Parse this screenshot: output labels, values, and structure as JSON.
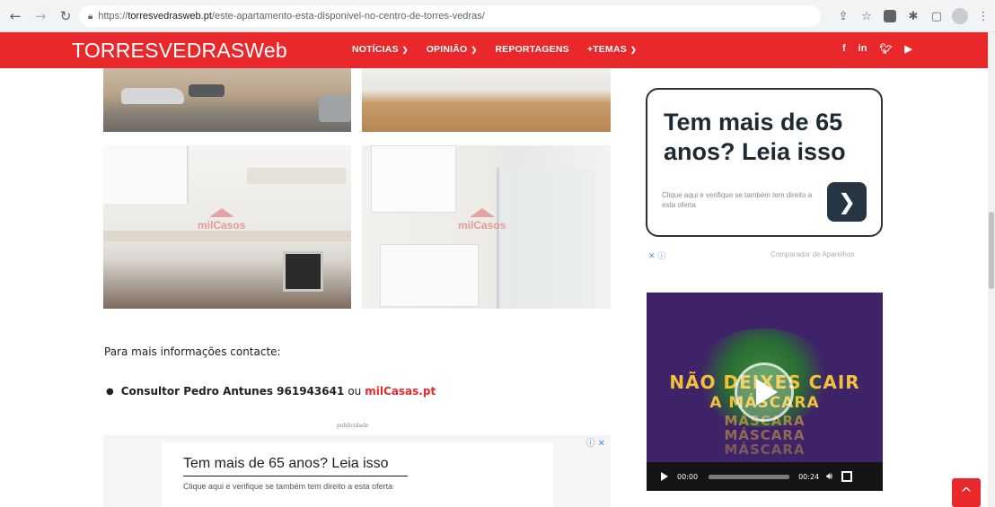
{
  "browser": {
    "url_prefix": "https://",
    "url_domain": "torresvedrasweb.pt",
    "url_path": "/este-apartamento-esta-disponivel-no-centro-de-torres-vedras/",
    "back_icon": "arrow-left-icon",
    "forward_icon": "arrow-right-icon",
    "reload_icon": "reload-icon",
    "lock_icon": "lock-icon"
  },
  "site": {
    "logo_bold": "TORRESVEDRAS",
    "logo_light": "Web",
    "brand_color": "#e8282b",
    "nav": [
      {
        "label": "NOTÍCIAS",
        "has_caret": true
      },
      {
        "label": "OPINIÃO",
        "has_caret": true
      },
      {
        "label": "REPORTAGENS",
        "has_caret": false
      },
      {
        "label": "+TEMAS",
        "has_caret": true
      }
    ],
    "social": [
      "f",
      "in",
      "twitter-icon",
      "youtube-icon"
    ]
  },
  "photos": {
    "watermark": "milCasos"
  },
  "content": {
    "info_text": "Para mais informações contacte:",
    "contact_name": "Consultor Pedro Antunes 961943641",
    "contact_or": "ou",
    "contact_link": "milCasas.pt",
    "pub_label": "publicidade"
  },
  "bottom_ad": {
    "title": "Tem mais de 65 anos? Leia isso",
    "subtitle": "Clique aqui e verifique se também tem direito a esta oferta",
    "choices": "ⓘ ✕"
  },
  "side_ad": {
    "title": "Tem mais de 65 anos? Leia isso",
    "subtitle": "Clique aqui e verifique se também tem direito a esta oferta",
    "arrow": "❯",
    "close": "✕ ⓘ",
    "source": "Comparador de Aparelhos"
  },
  "video": {
    "line1": "NÃO DEIXES CAIR",
    "line2": "A MÁSCARA",
    "line3": "MÁSCARA",
    "line4": "MÁSCARA",
    "line5": "MÁSCARA",
    "current_time": "00:00",
    "duration": "00:24",
    "progress": 0
  },
  "back_to_top": "^"
}
